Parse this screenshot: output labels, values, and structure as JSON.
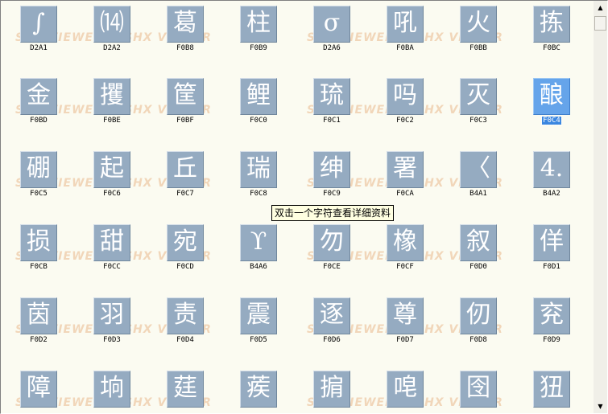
{
  "watermark_text": "SHX VIEWER",
  "tooltip": "双击一个字符查看详细资料",
  "scrollbar": {
    "up_icon": "▲",
    "down_icon": "▼"
  },
  "rows": [
    [
      {
        "glyph": "∫",
        "code": "D2A1"
      },
      {
        "glyph": "⒁",
        "code": "D2A2"
      },
      {
        "glyph": "葛",
        "code": "F0B8"
      },
      {
        "glyph": "柱",
        "code": "F0B9"
      },
      {
        "glyph": "σ",
        "code": "D2A6"
      },
      {
        "glyph": "吼",
        "code": "F0BA"
      },
      {
        "glyph": "火",
        "code": "F0BB"
      },
      {
        "glyph": "拣",
        "code": "F0BC"
      }
    ],
    [
      {
        "glyph": "金",
        "code": "F0BD"
      },
      {
        "glyph": "攫",
        "code": "F0BE"
      },
      {
        "glyph": "筐",
        "code": "F0BF"
      },
      {
        "glyph": "鲤",
        "code": "F0C0"
      },
      {
        "glyph": "琉",
        "code": "F0C1"
      },
      {
        "glyph": "吗",
        "code": "F0C2"
      },
      {
        "glyph": "灭",
        "code": "F0C3"
      },
      {
        "glyph": "酿",
        "code": "F0C4",
        "selected": true
      }
    ],
    [
      {
        "glyph": "硼",
        "code": "F0C5"
      },
      {
        "glyph": "起",
        "code": "F0C6"
      },
      {
        "glyph": "丘",
        "code": "F0C7"
      },
      {
        "glyph": "瑞",
        "code": "F0C8"
      },
      {
        "glyph": "绅",
        "code": "F0C9"
      },
      {
        "glyph": "署",
        "code": "F0CA"
      },
      {
        "glyph": "〈",
        "code": "B4A1"
      },
      {
        "glyph": "4.",
        "code": "B4A2"
      }
    ],
    [
      {
        "glyph": "损",
        "code": "F0CB"
      },
      {
        "glyph": "甜",
        "code": "F0CC"
      },
      {
        "glyph": "宛",
        "code": "F0CD"
      },
      {
        "glyph": "ϒ",
        "code": "B4A6"
      },
      {
        "glyph": "勿",
        "code": "F0CE"
      },
      {
        "glyph": "橡",
        "code": "F0CF"
      },
      {
        "glyph": "叙",
        "code": "F0D0"
      },
      {
        "glyph": "佯",
        "code": "F0D1"
      }
    ],
    [
      {
        "glyph": "茵",
        "code": "F0D2"
      },
      {
        "glyph": "羽",
        "code": "F0D3"
      },
      {
        "glyph": "责",
        "code": "F0D4"
      },
      {
        "glyph": "震",
        "code": "F0D5"
      },
      {
        "glyph": "逐",
        "code": "F0D6"
      },
      {
        "glyph": "尊",
        "code": "F0D7"
      },
      {
        "glyph": "仞",
        "code": "F0D8"
      },
      {
        "glyph": "兖",
        "code": "F0D9"
      }
    ],
    [
      {
        "glyph": "障",
        "code": ""
      },
      {
        "glyph": "垧",
        "code": ""
      },
      {
        "glyph": "莛",
        "code": ""
      },
      {
        "glyph": "蒺",
        "code": ""
      },
      {
        "glyph": "掮",
        "code": ""
      },
      {
        "glyph": "唣",
        "code": ""
      },
      {
        "glyph": "囹",
        "code": ""
      },
      {
        "glyph": "狃",
        "code": ""
      }
    ]
  ]
}
